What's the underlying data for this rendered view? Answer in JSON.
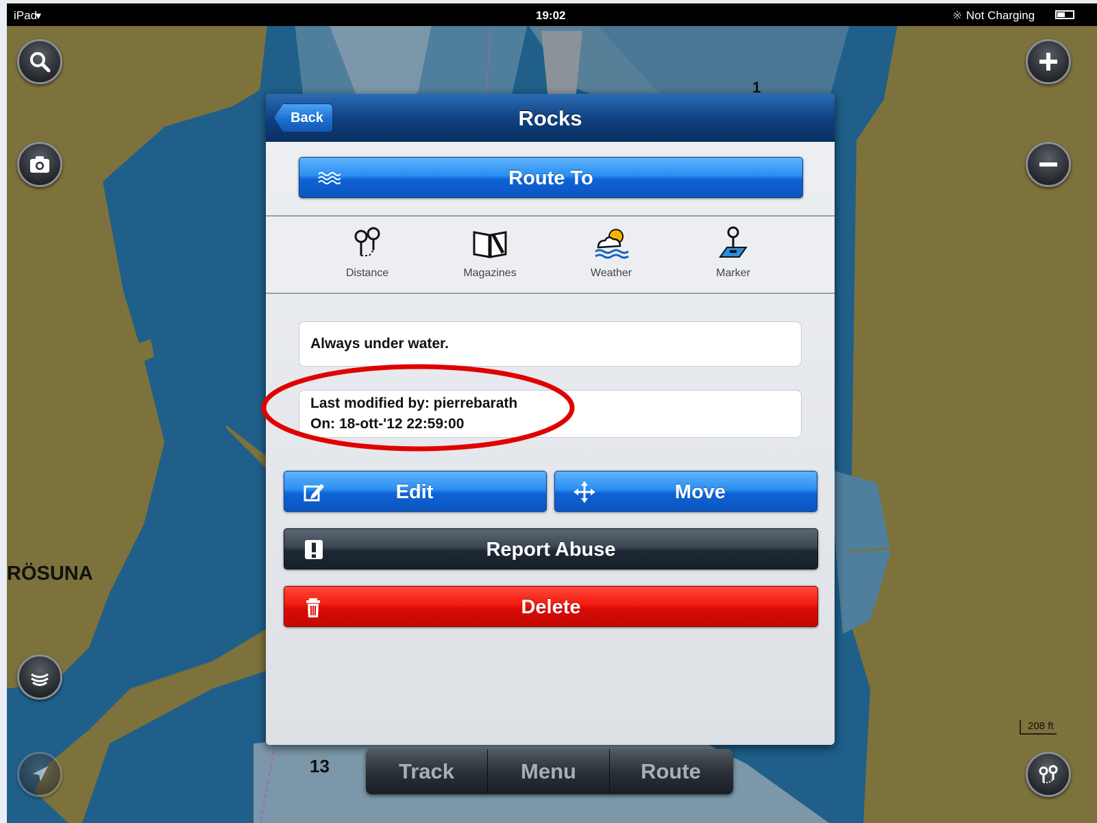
{
  "status_bar": {
    "device": "iPad",
    "time": "19:02",
    "battery": "Not Charging"
  },
  "map": {
    "place_label": "RÖSUNA",
    "depth_13": "13",
    "depth_1": "1",
    "scale": "208 ft"
  },
  "map_buttons": [
    "search-icon",
    "camera-icon",
    "zoom-in-icon",
    "zoom-out-icon",
    "layers-icon",
    "locate-icon",
    "route-icon"
  ],
  "popup": {
    "title": "Rocks",
    "back_label": "Back",
    "route_to_label": "Route To",
    "tools": [
      {
        "label": "Distance",
        "icon": "distance-icon"
      },
      {
        "label": "Magazines",
        "icon": "book-icon"
      },
      {
        "label": "Weather",
        "icon": "weather-icon"
      },
      {
        "label": "Marker",
        "icon": "marker-icon"
      }
    ],
    "description": "Always under water.",
    "modified_by": "Last modified by: pierrebarath",
    "modified_on": "On: 18-ott-'12 22:59:00",
    "edit_label": "Edit",
    "move_label": "Move",
    "report_label": "Report Abuse",
    "delete_label": "Delete"
  },
  "tabbar": {
    "track": "Track",
    "menu": "Menu",
    "route": "Route"
  },
  "colors": {
    "accent_blue": "#1d7be3",
    "danger_red": "#e5120a",
    "header_navy": "#0e3f7e",
    "land": "#7a6f3a",
    "deep_water": "#1f5f8a",
    "highlight_ellipse": "#e00000"
  }
}
